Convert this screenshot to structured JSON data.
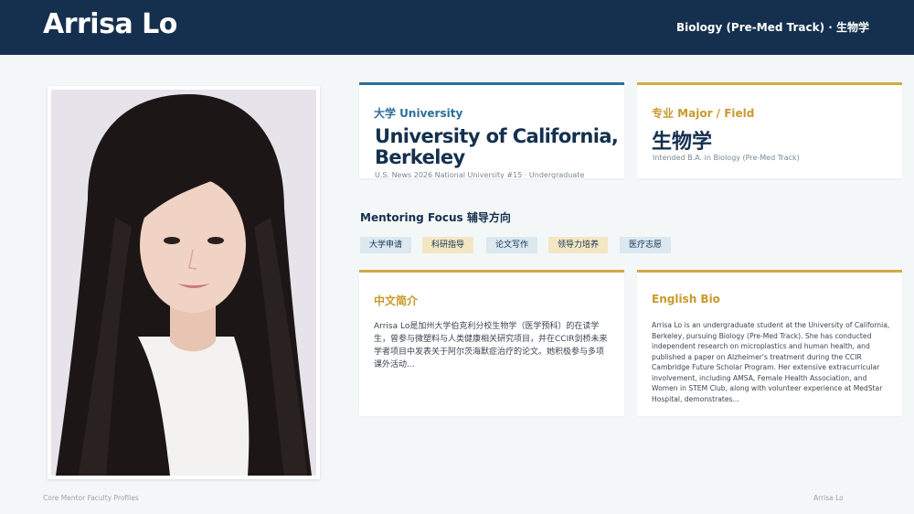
{
  "header": {
    "name": "Arrisa Lo",
    "track": "Biology (Pre-Med Track) · 生物学"
  },
  "university": {
    "label": "大学 University",
    "name": "University of California, Berkeley",
    "subtitle": "U.S. News 2026 National University #15 · Undergraduate"
  },
  "major": {
    "label": "专业 Major / Field",
    "name": "生物学",
    "subtitle": "Intended B.A. in Biology (Pre-Med Track)"
  },
  "focus": {
    "title": "Mentoring Focus 辅导方向",
    "tags": [
      {
        "label": "大学申请",
        "style": "blue"
      },
      {
        "label": "科研指导",
        "style": "gold"
      },
      {
        "label": "论文写作",
        "style": "blue"
      },
      {
        "label": "领导力培养",
        "style": "gold"
      },
      {
        "label": "医疗志愿",
        "style": "blue"
      }
    ]
  },
  "bio_cn": {
    "title": "中文简介",
    "text": "Arrisa Lo是加州大学伯克利分校生物学（医学预科）的在读学生，曾参与微塑料与人类健康相关研究项目，并在CCIR剑桥未来学者项目中发表关于阿尔茨海默症治疗的论文。她积极参与多项课外活动..."
  },
  "bio_en": {
    "title": "English Bio",
    "text": "Arrisa Lo is an undergraduate student at the University of California, Berkeley, pursuing Biology (Pre-Med Track). She has conducted independent research on microplastics and human health, and published a paper on Alzheimer's treatment during the CCIR Cambridge Future Scholar Program. Her extensive extracurricular involvement, including AMSA, Female Health Association, and Women in STEM Club, along with volunteer experience at MedStar Hospital, demonstrates..."
  },
  "footer": {
    "left": "Core Mentor Faculty Profiles",
    "right": "Arrisa Lo"
  }
}
